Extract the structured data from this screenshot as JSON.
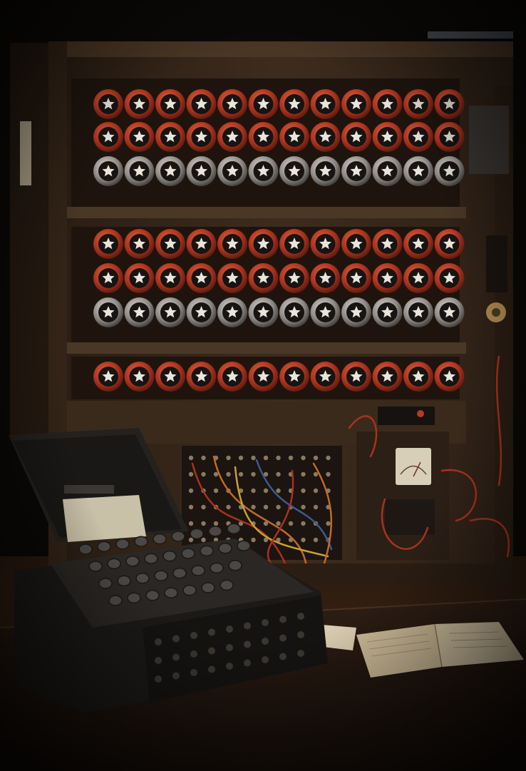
{
  "scene": {
    "palette": {
      "background": "#0b0907",
      "floor": "#3a2414",
      "cabinet_wood": "#3b2a1c",
      "cabinet_dark": "#1e140d",
      "shelf": "#4a3726",
      "drum_red": "#b83a22",
      "drum_silver": "#8e8a86",
      "drum_face": "#171412",
      "star": "#e9e4dc",
      "enigma_body": "#1c1a18",
      "enigma_lid": "#24211e",
      "enigma_screen": "#c9c0a8",
      "key": "#4a4744",
      "table": "#2a1b12",
      "paper": "#d9ccb0",
      "book": "#cdbb98",
      "wire_red": "#a8321e",
      "wire_orange": "#c46a20",
      "wire_yellow": "#c9a132",
      "wire_blue": "#3d5a8a",
      "brass": "#b08a4e"
    },
    "drum_rows": [
      {
        "count": 12,
        "style": "red"
      },
      {
        "count": 12,
        "style": "red"
      },
      {
        "count": 12,
        "style": "silver"
      },
      {
        "count": 12,
        "style": "red"
      },
      {
        "count": 12,
        "style": "red"
      },
      {
        "count": 12,
        "style": "silver"
      },
      {
        "count": 12,
        "style": "red"
      }
    ],
    "enigma_key_rows": [
      9,
      9,
      8,
      7
    ],
    "plugboard_columns": 12,
    "plugboard_rows": 6,
    "objects": [
      "bombe-machine-cabinet",
      "rotor-drums",
      "plugboard-panel",
      "gauge-dial",
      "enigma-machine",
      "wooden-table",
      "open-book",
      "paper-sheet"
    ]
  }
}
